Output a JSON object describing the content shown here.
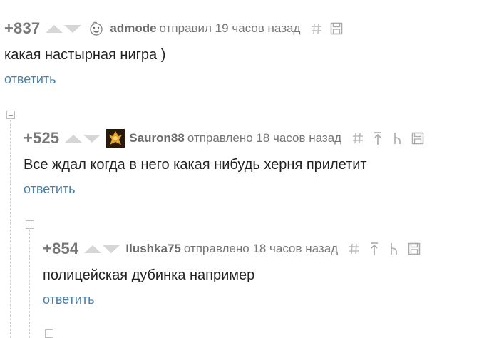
{
  "comments": [
    {
      "rating": "+837",
      "author": "admode",
      "meta": "отправил 19 часов назад",
      "text": "какая настырная нигра )",
      "reply_label": "ответить"
    },
    {
      "rating": "+525",
      "author": "Sauron88",
      "meta": "отправлено 18 часов назад",
      "text": "Все ждал когда в него какая нибудь херня прилетит",
      "reply_label": "ответить"
    },
    {
      "rating": "+854",
      "author": "Ilushka75",
      "meta": "отправлено 18 часов назад",
      "text": "полицейская дубинка например",
      "reply_label": "ответить"
    }
  ],
  "icons": {
    "hash": "hash-icon",
    "save": "save-icon",
    "parent": "go-to-parent-icon",
    "branch": "thread-branch-icon",
    "collapse": "collapse-icon",
    "avatar_face": "smiley-face-icon",
    "avatar_user": "user-avatar"
  },
  "colors": {
    "reply_link": "#4a7fa8",
    "meta_gray": "#777777",
    "vote_arrow": "#d6d6d6"
  }
}
